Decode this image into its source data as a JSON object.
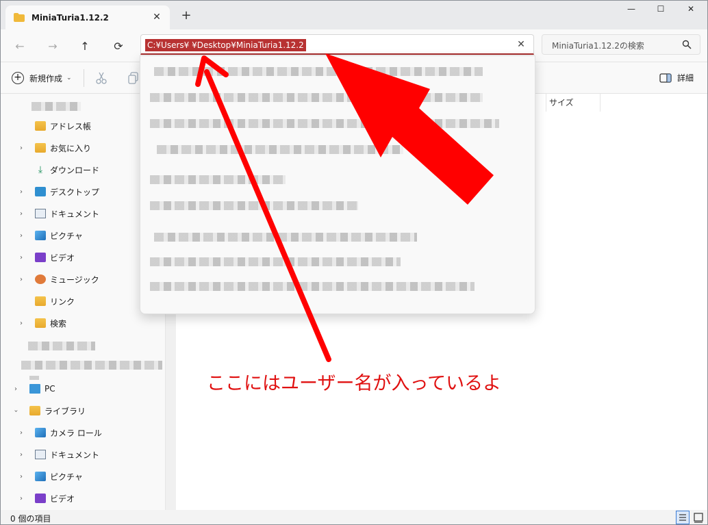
{
  "tab": {
    "title": "MiniaTuria1.12.2",
    "close": "✕",
    "new": "+"
  },
  "window_controls": {
    "minimize": "—",
    "maximize": "☐",
    "close": "✕"
  },
  "nav": {
    "back": "←",
    "forward": "→",
    "up": "↑",
    "refresh": "⟳"
  },
  "address": {
    "path": "C:¥Users¥     ¥Desktop¥MiniaTuria1.12.2",
    "clear": "✕"
  },
  "search": {
    "placeholder": "MiniaTuria1.12.2の検索"
  },
  "commands": {
    "new_label": "新規作成",
    "details_label": "詳細"
  },
  "sidebar": {
    "items": [
      {
        "label": "アドレス帳"
      },
      {
        "label": "お気に入り"
      },
      {
        "label": "ダウンロード"
      },
      {
        "label": "デスクトップ"
      },
      {
        "label": "ドキュメント"
      },
      {
        "label": "ピクチャ"
      },
      {
        "label": "ビデオ"
      },
      {
        "label": "ミュージック"
      },
      {
        "label": "リンク"
      },
      {
        "label": "検索"
      },
      {
        "label": "PC"
      },
      {
        "label": "ライブラリ"
      },
      {
        "label": "カメラ ロール"
      },
      {
        "label": "ドキュメント"
      },
      {
        "label": "ピクチャ"
      },
      {
        "label": "ビデオ"
      }
    ]
  },
  "content": {
    "column_size": "サイズ"
  },
  "status": {
    "items_count": "0 個の項目"
  },
  "annotation": {
    "text": "ここにはユーザー名が入っているよ",
    "color": "#e01010"
  },
  "colors": {
    "accent": "#b83232",
    "arrow": "#ff0000"
  }
}
